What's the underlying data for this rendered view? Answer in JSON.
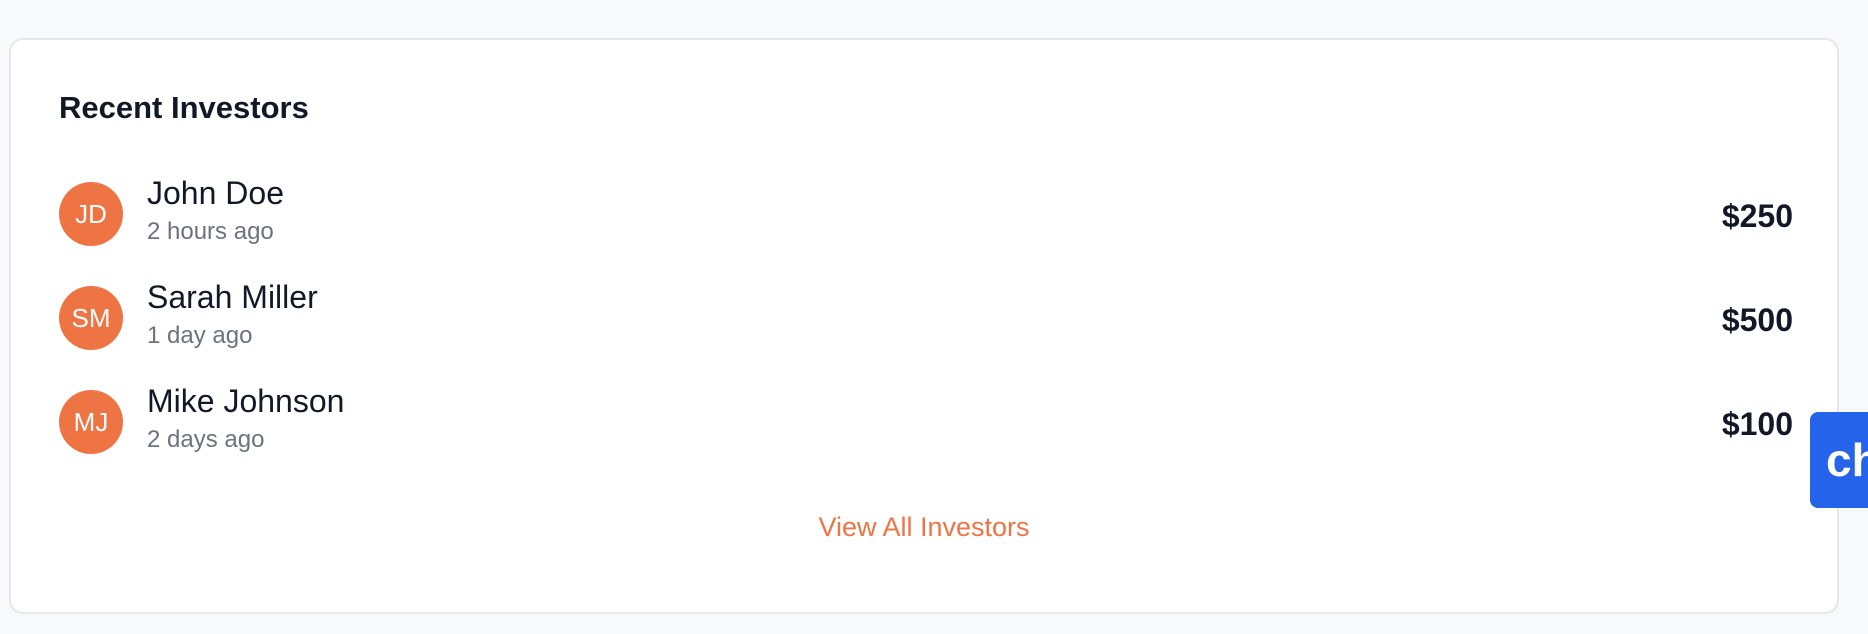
{
  "card": {
    "title": "Recent Investors",
    "view_all_label": "View All Investors"
  },
  "investors": [
    {
      "initials": "JD",
      "name": "John Doe",
      "time": "2 hours ago",
      "amount": "$250"
    },
    {
      "initials": "SM",
      "name": "Sarah Miller",
      "time": "1 day ago",
      "amount": "$500"
    },
    {
      "initials": "MJ",
      "name": "Mike Johnson",
      "time": "2 days ago",
      "amount": "$100"
    }
  ],
  "chat_widget": {
    "label": "ch"
  },
  "colors": {
    "avatar_bg": "#ef7444",
    "accent_link": "#ef7444",
    "chat_widget_bg": "#2563eb"
  }
}
